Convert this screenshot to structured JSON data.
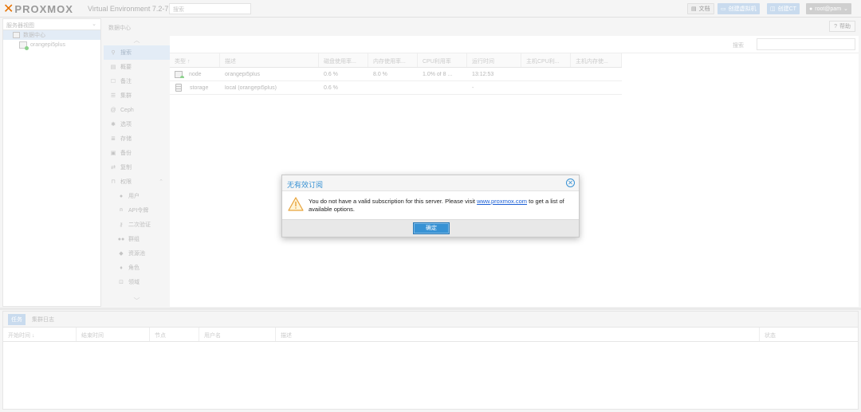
{
  "header": {
    "logo_text": "PROXMOX",
    "product": "Virtual Environment 7.2-7",
    "search_placeholder": "搜索",
    "docs_label": "文档",
    "create_vm_label": "创建虚拟机",
    "create_ct_label": "创建CT",
    "user_label": "root@pam"
  },
  "tree": {
    "view_label": "服务器视图",
    "datacenter": "数据中心",
    "node": "orangepi5plus"
  },
  "content": {
    "breadcrumb": "数据中心",
    "help_label": "帮助",
    "search_label": "搜索"
  },
  "nav": {
    "items": [
      {
        "label": "搜索",
        "icon": "search-icon",
        "selected": true
      },
      {
        "label": "概要",
        "icon": "summary-icon"
      },
      {
        "label": "备注",
        "icon": "notes-icon"
      },
      {
        "label": "集群",
        "icon": "cluster-icon"
      },
      {
        "label": "Ceph",
        "icon": "ceph-icon"
      },
      {
        "label": "选项",
        "icon": "gear-icon"
      },
      {
        "label": "存储",
        "icon": "storage-icon"
      },
      {
        "label": "备份",
        "icon": "backup-icon"
      },
      {
        "label": "复制",
        "icon": "replication-icon"
      },
      {
        "label": "权限",
        "icon": "unlock-icon",
        "expandable": true
      }
    ],
    "sub_items": [
      {
        "label": "用户",
        "icon": "user-icon"
      },
      {
        "label": "API令牌",
        "icon": "token-icon"
      },
      {
        "label": "二次验证",
        "icon": "key-icon"
      },
      {
        "label": "群组",
        "icon": "users-icon"
      },
      {
        "label": "资源池",
        "icon": "tags-icon"
      },
      {
        "label": "角色",
        "icon": "role-icon"
      },
      {
        "label": "领域",
        "icon": "realm-icon"
      }
    ]
  },
  "grid": {
    "columns": [
      "类型 ↑",
      "描述",
      "磁盘使用率...",
      "内存使用率...",
      "CPU利用率",
      "运行时间",
      "主机CPU利...",
      "主机内存使..."
    ],
    "rows": [
      {
        "type": "node",
        "desc": "orangepi5plus",
        "disk": "0.6 %",
        "mem": "8.0 %",
        "cpu": "1.0% of 8 ...",
        "uptime": "13:12:53",
        "hcpu": "",
        "hmem": ""
      },
      {
        "type": "storage",
        "desc": "local (orangepi5plus)",
        "disk": "0.6 %",
        "mem": "",
        "cpu": "",
        "uptime": "-",
        "hcpu": "",
        "hmem": ""
      }
    ]
  },
  "bottom": {
    "tabs": [
      "任务",
      "集群日志"
    ],
    "columns": [
      "开始时间 ↓",
      "结束时间",
      "节点",
      "用户名",
      "描述",
      "状态"
    ]
  },
  "modal": {
    "title": "无有效订阅",
    "message_before": "You do not have a valid subscription for this server. Please visit ",
    "link_text": "www.proxmox.com",
    "message_after": " to get a list of available options.",
    "ok_label": "确定"
  },
  "colors": {
    "accent": "#3892d4",
    "brand_orange": "#e57000",
    "selected_bg": "#e3ecf6"
  }
}
